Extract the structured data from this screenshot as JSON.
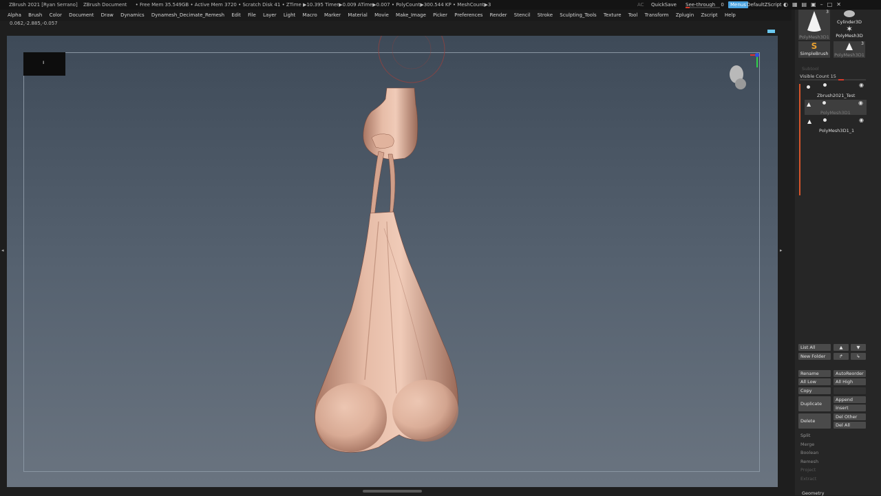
{
  "titlebar": {
    "app": "ZBrush 2021 [Ryan Serrano]",
    "doc": "ZBrush Document",
    "stats": "• Free Mem 35.549GB • Active Mem 3720 • Scratch Disk 41 •  ZTime ▶10.395 Timer▶0.009 ATime▶0.007 • PolyCount▶300.544 KP  • MeshCount▶3",
    "ac": "AC",
    "quicksave": "QuickSave",
    "seethrough": "See-through",
    "seethrough_value": "0",
    "menus": "Menus",
    "script": "DefaultZScript"
  },
  "menubar": {
    "items": [
      "Alpha",
      "Brush",
      "Color",
      "Document",
      "Draw",
      "Dynamics",
      "Dynamesh_Decimate_Remesh",
      "Edit",
      "File",
      "Layer",
      "Light",
      "Macro",
      "Marker",
      "Material",
      "Movie",
      "Make_Image",
      "Picker",
      "Preferences",
      "Render",
      "Stencil",
      "Stroke",
      "Sculpting_Tools",
      "Texture",
      "Tool",
      "Transform",
      "Zplugin",
      "Zscript",
      "Help"
    ]
  },
  "coords": "0.062,-2.885,-0.057",
  "thumb_char": "ı",
  "tool_palette": {
    "slots": [
      "PolyMesh3D1",
      "Cylinder3D",
      "PolyMesh3D",
      "SimpleBrush",
      "PolyMesh3D1"
    ],
    "slot_counts": [
      "3",
      "3"
    ]
  },
  "subtool": {
    "header": "Subtool",
    "visible_count": "Visible Count 15",
    "items": [
      "Zbrush2021_Test",
      "PolyMesh3D1",
      "PolyMesh3D1_1"
    ]
  },
  "buttons": {
    "list_all": "List All",
    "new_folder": "New Folder",
    "rename": "Rename",
    "autoreorder": "AutoReorder",
    "all_low": "All Low",
    "all_high": "All High",
    "copy": "Copy",
    "duplicate": "Duplicate",
    "append": "Append",
    "insert": "Insert",
    "delete": "Delete",
    "del_other": "Del Other",
    "del_all": "Del All"
  },
  "sections": [
    "Split",
    "Merge",
    "Boolean",
    "Remesh",
    "Project",
    "Extract"
  ],
  "geometry": "Geometry",
  "colors": {
    "accent": "#4aa3df",
    "slider_red": "#d83a2a",
    "skin": "#d9ab94"
  }
}
